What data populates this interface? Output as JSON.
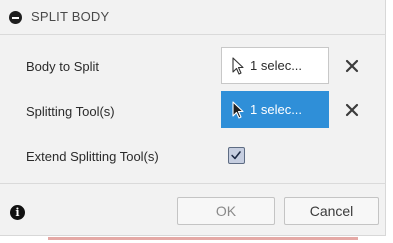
{
  "dialog": {
    "title": "SPLIT BODY",
    "rows": [
      {
        "label": "Body to Split",
        "selection": "1 selec..."
      },
      {
        "label": "Splitting Tool(s)",
        "selection": "1 selec..."
      },
      {
        "label": "Extend Splitting Tool(s)",
        "checked": true
      }
    ],
    "ok_label": "OK",
    "cancel_label": "Cancel"
  },
  "icons": {
    "header": "collapse-icon",
    "selection": "cursor-icon",
    "clear": "close-icon",
    "help": "info-icon"
  },
  "colors": {
    "active_selection": "#2f8fd8",
    "dialog_background": "#f2f2f2"
  }
}
